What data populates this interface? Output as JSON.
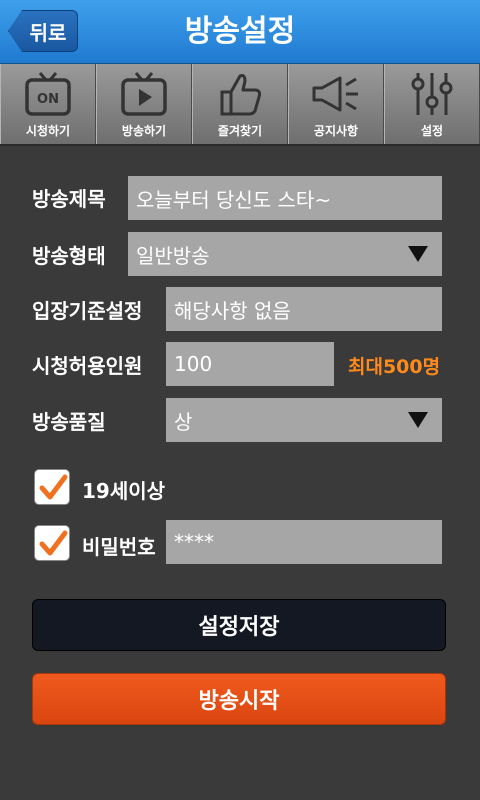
{
  "header": {
    "back_label": "뒤로",
    "title": "방송설정"
  },
  "tabs": [
    {
      "label": "시청하기",
      "icon": "tv-on-icon"
    },
    {
      "label": "방송하기",
      "icon": "tv-play-icon"
    },
    {
      "label": "즐겨찾기",
      "icon": "thumbs-up-icon"
    },
    {
      "label": "공지사항",
      "icon": "megaphone-icon"
    },
    {
      "label": "설정",
      "icon": "sliders-icon"
    }
  ],
  "form": {
    "title_label": "방송제목",
    "title_value": "오늘부터 당신도 스타~",
    "type_label": "방송형태",
    "type_value": "일반방송",
    "entry_label": "입장기준설정",
    "entry_value": "해당사항 없음",
    "viewers_label": "시청허용인원",
    "viewers_value": "100",
    "viewers_max": "최대500명",
    "quality_label": "방송품질",
    "quality_value": "상",
    "adult_label": "19세이상",
    "adult_checked": true,
    "password_label": "비밀번호",
    "password_checked": true,
    "password_value": "****"
  },
  "buttons": {
    "save": "설정저장",
    "start": "방송시작"
  },
  "colors": {
    "header": "#2a8de0",
    "accent": "#e8501a",
    "max_text": "#ff8a1c",
    "save_btn": "#141822"
  }
}
